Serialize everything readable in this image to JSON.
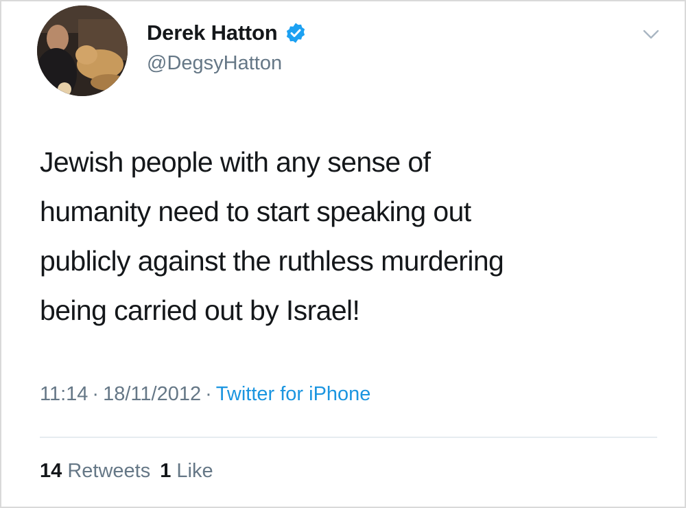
{
  "tweet": {
    "author": {
      "display_name": "Derek Hatton",
      "handle": "@DegsyHatton",
      "verified": true,
      "avatar_icon": "profile-photo"
    },
    "text_lines": [
      "Jewish people with any sense of",
      "humanity need to start speaking out",
      "publicly against the ruthless murdering",
      "being carried out by Israel!"
    ],
    "time": "11:14",
    "date": "18/11/2012",
    "separator": "·",
    "source": "Twitter for iPhone",
    "stats": {
      "retweets_count": "14",
      "retweets_label": "Retweets",
      "likes_count": "1",
      "likes_label": "Like"
    },
    "menu_icon": "chevron-down-icon"
  },
  "colors": {
    "text": "#14171a",
    "secondary": "#657786",
    "link": "#1b95e0",
    "verified_badge": "#1da1f2",
    "divider": "#e6ecf0"
  }
}
